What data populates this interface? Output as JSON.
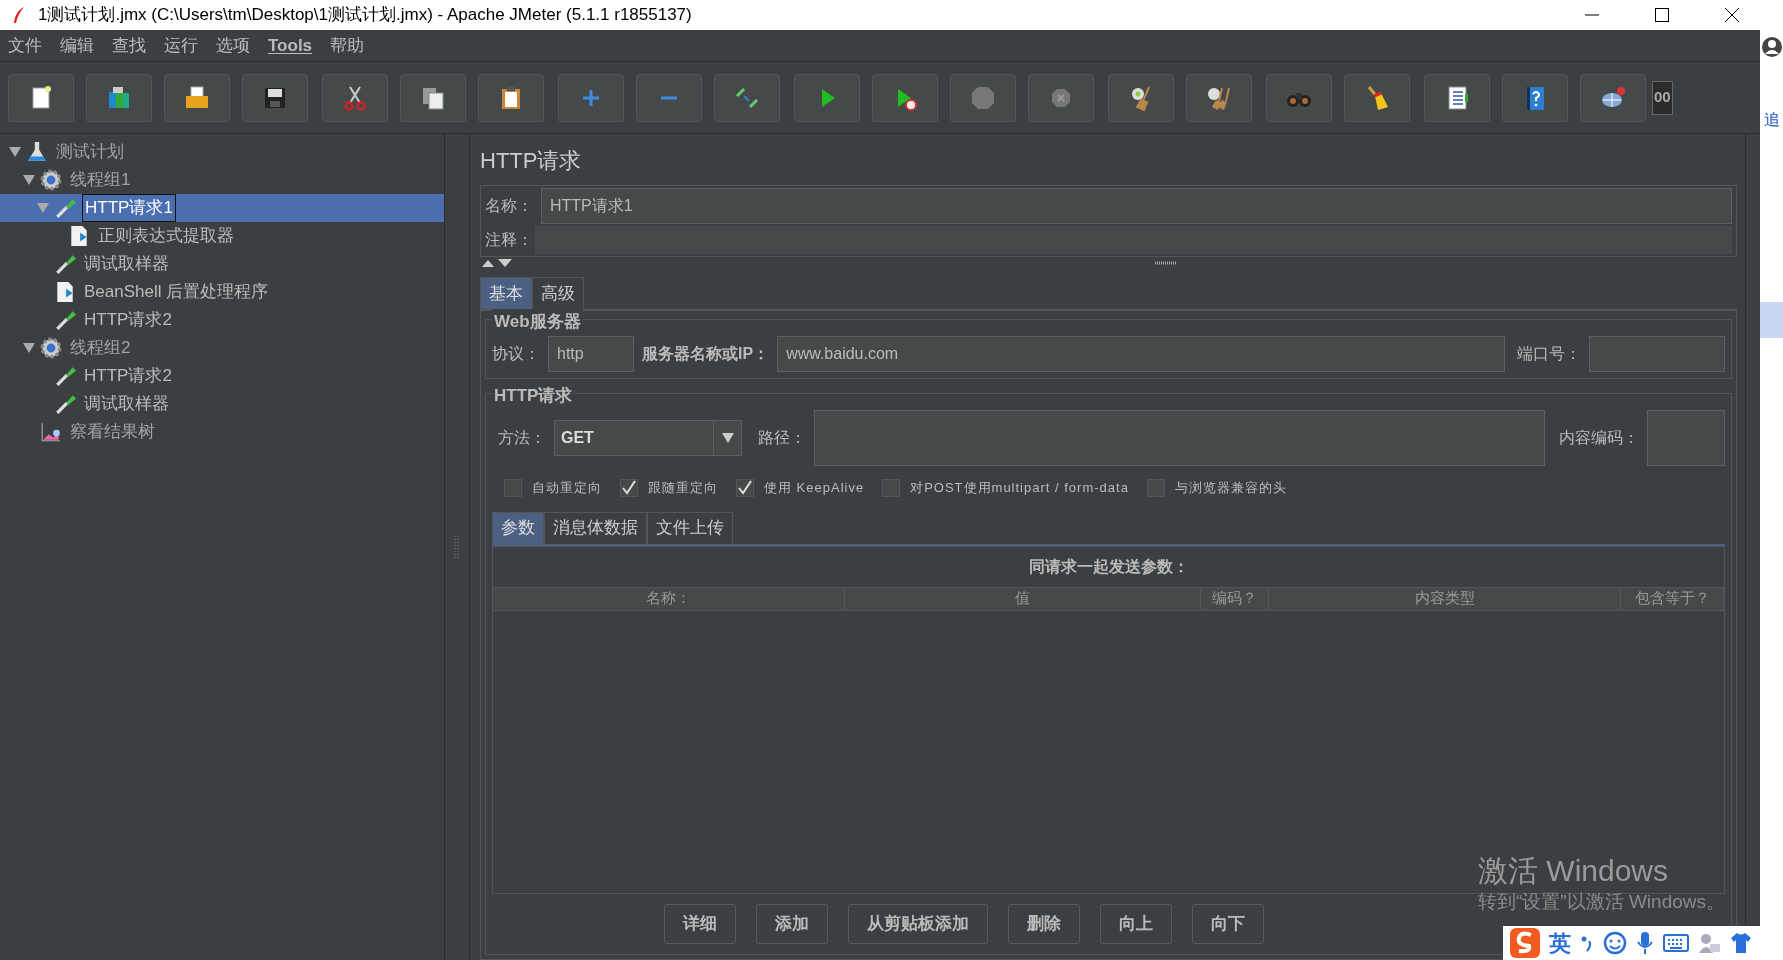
{
  "window": {
    "title": "1测试计划.jmx (C:\\Users\\tm\\Desktop\\1测试计划.jmx) - Apache JMeter (5.1.1 r1855137)"
  },
  "menu": [
    {
      "label": "文件"
    },
    {
      "label": "编辑"
    },
    {
      "label": "查找"
    },
    {
      "label": "运行"
    },
    {
      "label": "选项"
    },
    {
      "label": "Tools"
    },
    {
      "label": "帮助"
    }
  ],
  "toolbar": {
    "counter": "00"
  },
  "tree": [
    {
      "label": "测试计划",
      "kind": "plan",
      "expanded": true,
      "selected": false,
      "children": [
        {
          "label": "线程组1",
          "kind": "thread_group",
          "expanded": true,
          "selected": false,
          "children": [
            {
              "label": "HTTP请求1",
              "kind": "sampler",
              "expanded": true,
              "selected": true,
              "children": [
                {
                  "label": "正则表达式提取器",
                  "kind": "post_processor",
                  "selected": false
                }
              ]
            },
            {
              "label": "调试取样器",
              "kind": "sampler",
              "selected": false
            },
            {
              "label": "BeanShell 后置处理程序",
              "kind": "post_processor",
              "selected": false
            },
            {
              "label": "HTTP请求2",
              "kind": "sampler",
              "selected": false
            }
          ]
        },
        {
          "label": "线程组2",
          "kind": "thread_group",
          "expanded": true,
          "selected": false,
          "children": [
            {
              "label": "HTTP请求2",
              "kind": "sampler",
              "selected": false
            },
            {
              "label": "调试取样器",
              "kind": "sampler",
              "selected": false
            }
          ]
        },
        {
          "label": "察看结果树",
          "kind": "listener",
          "selected": false
        }
      ]
    }
  ],
  "panel": {
    "title": "HTTP请求",
    "name_label": "名称：",
    "name_value": "HTTP请求1",
    "comment_label": "注释：",
    "tabs": [
      {
        "label": "基本",
        "selected": true
      },
      {
        "label": "高级",
        "selected": false
      }
    ],
    "web_server": {
      "title": "Web服务器",
      "protocol_label": "协议：",
      "protocol_value": "http",
      "server_label": "服务器名称或IP：",
      "server_value": "www.baidu.com",
      "port_label": "端口号："
    },
    "http_request": {
      "title": "HTTP请求",
      "method_label": "方法：",
      "method_value": "GET",
      "path_label": "路径：",
      "encoding_label": "内容编码：",
      "options": [
        {
          "label": "自动重定向",
          "checked": false
        },
        {
          "label": "跟随重定向",
          "checked": true
        },
        {
          "label": "使用 KeepAlive",
          "checked": true
        },
        {
          "label": "对POST使用multipart / form-data",
          "checked": false
        },
        {
          "label": "与浏览器兼容的头",
          "checked": false
        }
      ]
    },
    "sub_tabs": [
      {
        "label": "参数",
        "selected": true
      },
      {
        "label": "消息体数据",
        "selected": false
      },
      {
        "label": "文件上传",
        "selected": false
      }
    ],
    "table": {
      "caption": "同请求一起发送参数：",
      "columns": [
        "名称：",
        "值",
        "编码？",
        "内容类型",
        "包含等于？"
      ]
    },
    "buttons": [
      "详细",
      "添加",
      "从剪贴板添加",
      "删除",
      "向上",
      "向下"
    ]
  },
  "os_notice": {
    "title": "激活 Windows",
    "subtitle": "转到“设置”以激活 Windows。"
  },
  "ime_bar": {
    "mode": "英"
  },
  "side_window": {
    "text": "追"
  }
}
